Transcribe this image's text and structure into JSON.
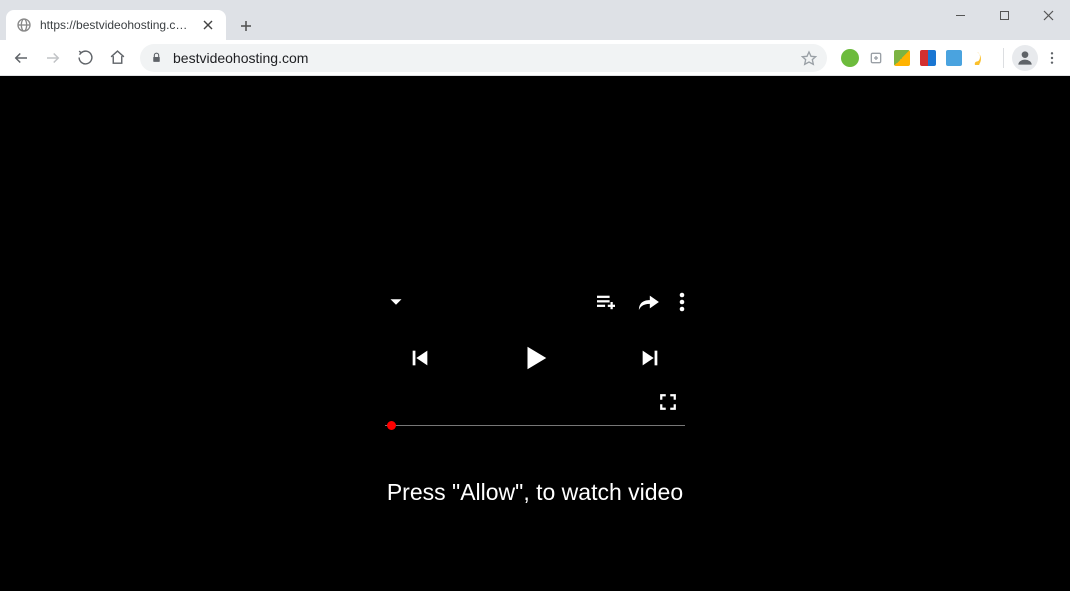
{
  "browser": {
    "tab_title": "https://bestvideohosting.com",
    "url_display": "bestvideohosting.com"
  },
  "player": {
    "icons": {
      "chevron": "chevron-down",
      "queue": "playlist-add",
      "share": "share",
      "more": "more-vert",
      "prev": "skip-previous",
      "play": "play",
      "next": "skip-next",
      "fullscreen": "fullscreen"
    },
    "prompt_text": "Press \"Allow\", to watch video"
  }
}
